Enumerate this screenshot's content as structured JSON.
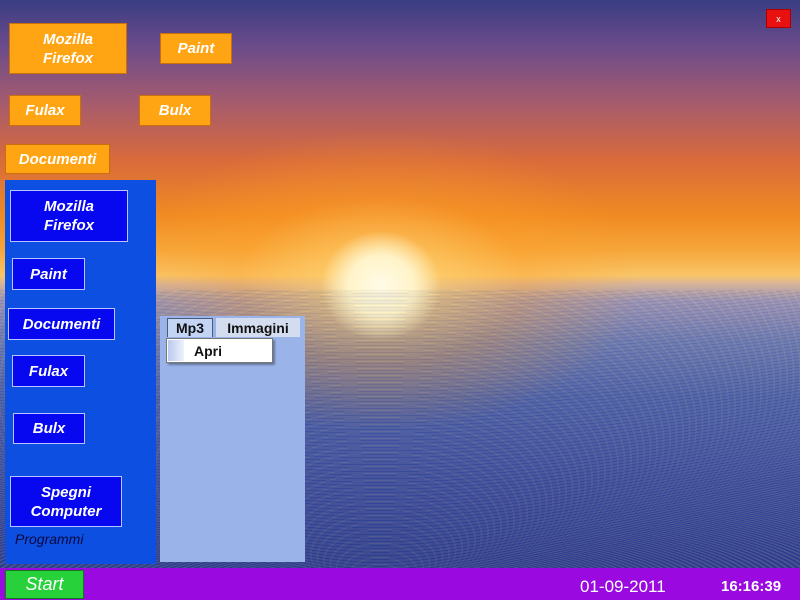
{
  "desktop": {
    "icons": [
      {
        "label": "Mozilla\nFirefox"
      },
      {
        "label": "Paint"
      },
      {
        "label": "Fulax"
      },
      {
        "label": "Bulx"
      },
      {
        "label": "Documenti"
      }
    ],
    "close_label": "x"
  },
  "start_menu": {
    "items": [
      {
        "label": "Mozilla\nFirefox"
      },
      {
        "label": "Paint"
      },
      {
        "label": "Documenti"
      },
      {
        "label": "Fulax"
      },
      {
        "label": "Bulx"
      },
      {
        "label": "Spegni\nComputer"
      }
    ],
    "footer_label": "Programmi"
  },
  "tab_panel": {
    "tabs": [
      {
        "label": "Mp3",
        "selected": true
      },
      {
        "label": "Immagini",
        "selected": false
      }
    ],
    "context_menu": {
      "items": [
        {
          "label": "Apri"
        }
      ]
    }
  },
  "taskbar": {
    "start_label": "Start",
    "date": "01-09-2011",
    "time": "16:16:39"
  },
  "colors": {
    "desktop_icon": "#ffa514",
    "start_panel": "#0d4fe0",
    "start_panel_button": "#0808f0",
    "tab_panel": "#9ab4ea",
    "taskbar": "#9a0ae0",
    "start_button": "#26d13a",
    "close_button": "#e81010"
  }
}
